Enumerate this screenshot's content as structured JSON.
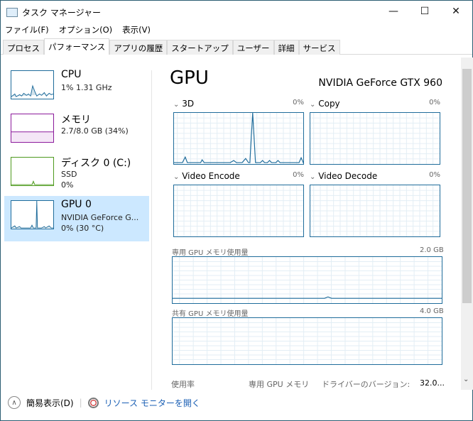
{
  "window": {
    "title": "タスク マネージャー",
    "minimize": "—",
    "maximize": "☐",
    "close": "✕"
  },
  "menu": [
    "ファイル(F)",
    "オプション(O)",
    "表示(V)"
  ],
  "tabs": [
    "プロセス",
    "パフォーマンス",
    "アプリの履歴",
    "スタートアップ",
    "ユーザー",
    "詳細",
    "サービス"
  ],
  "active_tab": 1,
  "sidebar": [
    {
      "name": "CPU",
      "line1": "1%  1.31 GHz",
      "line2": "",
      "color": "#1f6c9b"
    },
    {
      "name": "メモリ",
      "line1": "2.7/8.0 GB (34%)",
      "line2": "",
      "color": "#8b1a9b"
    },
    {
      "name": "ディスク 0 (C:)",
      "line1": "SSD",
      "line2": "0%",
      "color": "#4e9a1e"
    },
    {
      "name": "GPU 0",
      "line1": "NVIDIA GeForce G...",
      "line2": "0%  (30 °C)",
      "color": "#1f6c9b"
    }
  ],
  "main": {
    "title": "GPU",
    "model": "NVIDIA GeForce GTX 960",
    "engines": [
      {
        "label": "3D",
        "pct": "0%"
      },
      {
        "label": "Copy",
        "pct": "0%"
      },
      {
        "label": "Video Encode",
        "pct": "0%"
      },
      {
        "label": "Video Decode",
        "pct": "0%"
      }
    ],
    "dedicated": {
      "label": "専用 GPU メモリ使用量",
      "max": "2.0 GB"
    },
    "shared": {
      "label": "共有 GPU メモリ使用量",
      "max": "4.0 GB"
    },
    "stats": {
      "usage": "使用率",
      "dedicated": "専用 GPU メモリ",
      "driver_label": "ドライバーのバージョン:",
      "driver_value": "32.0..."
    }
  },
  "footer": {
    "simple": "簡易表示(D)",
    "monitor": "リソース モニターを開く"
  }
}
